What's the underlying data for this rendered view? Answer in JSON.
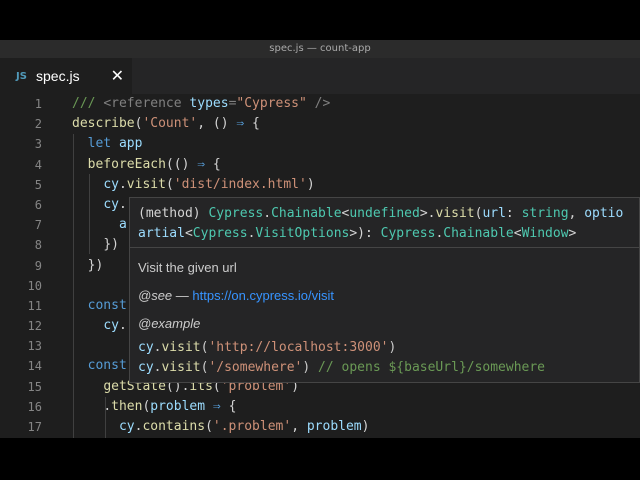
{
  "window": {
    "title": "spec.js — count-app"
  },
  "tab": {
    "icon": "JS",
    "label": "spec.js",
    "close_glyph": "✕"
  },
  "line_numbers": [
    "1",
    "2",
    "3",
    "4",
    "5",
    "6",
    "7",
    "8",
    "9",
    "10",
    "11",
    "12",
    "13",
    "14",
    "15",
    "16",
    "17"
  ],
  "code": {
    "l1": {
      "a": "/// ",
      "b": "<reference",
      "c": " types",
      "d": "=",
      "e": "\"Cypress\"",
      "f": " />"
    },
    "l2": {
      "a": "describe",
      "b": "(",
      "c": "'Count'",
      "d": ", () ",
      "e": "⇒",
      "f": " {"
    },
    "l3": {
      "a": "let",
      "b": " app"
    },
    "l4": {
      "a": "beforeEach",
      "b": "(() ",
      "c": "⇒",
      "d": " {"
    },
    "l5": {
      "a": "cy",
      "b": ".",
      "c": "visit",
      "d": "(",
      "e": "'dist/index.html'",
      "f": ")"
    },
    "l6": {
      "a": "cy",
      "b": "."
    },
    "l7": {
      "a": "a"
    },
    "l8": {
      "a": "})"
    },
    "l9": {
      "a": "})"
    },
    "l11": {
      "a": "const"
    },
    "l12": {
      "a": "cy",
      "b": "."
    },
    "l14": {
      "a": "const"
    },
    "l15": {
      "a": "getState",
      "b": "().",
      "c": "its",
      "d": "(",
      "e": "'problem'",
      "f": ")"
    },
    "l16": {
      "a": ".",
      "b": "then",
      "c": "(",
      "d": "problem",
      "e": " ⇒ ",
      "f": "{"
    },
    "l17": {
      "a": "cy",
      "b": ".",
      "c": "contains",
      "d": "(",
      "e": "'.problem'",
      "f": ", ",
      "g": "problem",
      "h": ")"
    }
  },
  "hover": {
    "sig1": {
      "a": "(method) ",
      "b": "Cypress",
      "c": ".",
      "d": "Chainable",
      "e": "<",
      "f": "undefined",
      "g": ">.",
      "h": "visit",
      "i": "(",
      "j": "url",
      "k": ": ",
      "l": "string",
      "m": ", ",
      "n": "optio"
    },
    "sig2": {
      "a": "artial",
      "b": "<",
      "c": "Cypress",
      "d": ".",
      "e": "VisitOptions",
      "f": ">): ",
      "g": "Cypress",
      "h": ".",
      "i": "Chainable",
      "j": "<",
      "k": "Window",
      "l": ">"
    },
    "description": "Visit the given url",
    "see_label": "@see",
    "see_dash": " — ",
    "see_link": "https://on.cypress.io/visit",
    "example_label": "@example",
    "ex1": {
      "a": "cy",
      "b": ".",
      "c": "visit",
      "d": "(",
      "e": "'http://localhost:3000'",
      "f": ")"
    },
    "ex2": {
      "a": "cy",
      "b": ".",
      "c": "visit",
      "d": "(",
      "e": "'/somewhere'",
      "f": ") ",
      "g": "// opens ${baseUrl}/somewhere"
    }
  }
}
